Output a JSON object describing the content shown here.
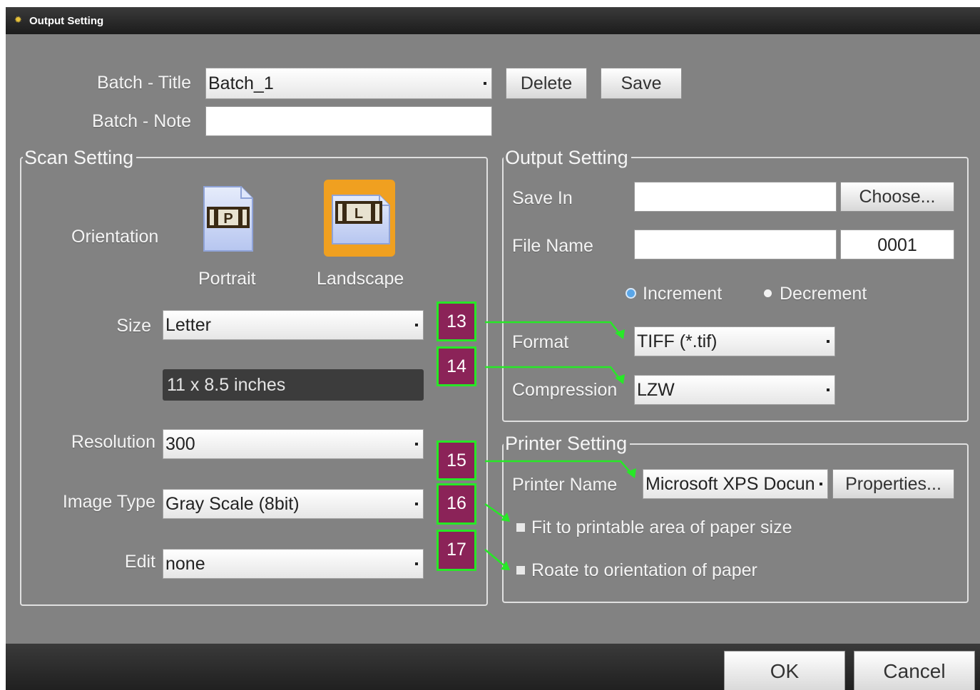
{
  "window": {
    "title": "Output Setting"
  },
  "batch": {
    "title_label": "Batch - Title",
    "title_value": "Batch_1",
    "note_label": "Batch - Note",
    "note_value": "",
    "delete_label": "Delete",
    "save_label": "Save"
  },
  "scan": {
    "group_label": "Scan Setting",
    "orientation_label": "Orientation",
    "portrait_label": "Portrait",
    "portrait_glyph": "P",
    "landscape_label": "Landscape",
    "landscape_glyph": "L",
    "selected_orientation": "Landscape",
    "size_label": "Size",
    "size_value": "Letter",
    "size_dimensions": "11 x 8.5 inches",
    "resolution_label": "Resolution",
    "resolution_value": "300",
    "image_type_label": "Image Type",
    "image_type_value": "Gray Scale (8bit)",
    "edit_label": "Edit",
    "edit_value": "none"
  },
  "output": {
    "group_label": "Output Setting",
    "save_in_label": "Save In",
    "save_in_value": "",
    "choose_label": "Choose...",
    "file_name_label": "File Name",
    "file_name_value": "",
    "counter_value": "0001",
    "increment_label": "Increment",
    "decrement_label": "Decrement",
    "selected_direction": "Increment",
    "format_label": "Format",
    "format_value": "TIFF (*.tif)",
    "compression_label": "Compression",
    "compression_value": "LZW"
  },
  "printer": {
    "group_label": "Printer Setting",
    "printer_name_label": "Printer Name",
    "printer_name_value": "Microsoft XPS Docun",
    "properties_label": "Properties...",
    "fit_label": "Fit to printable area of paper size",
    "rotate_label": "Roate to orientation of paper"
  },
  "markers": [
    "13",
    "14",
    "15",
    "16",
    "17"
  ],
  "footer": {
    "ok_label": "OK",
    "cancel_label": "Cancel"
  },
  "colors": {
    "marker_fill": "#8b2358",
    "marker_border": "#27e827",
    "selected_tile": "#f0a020",
    "window_bg": "#828282"
  }
}
